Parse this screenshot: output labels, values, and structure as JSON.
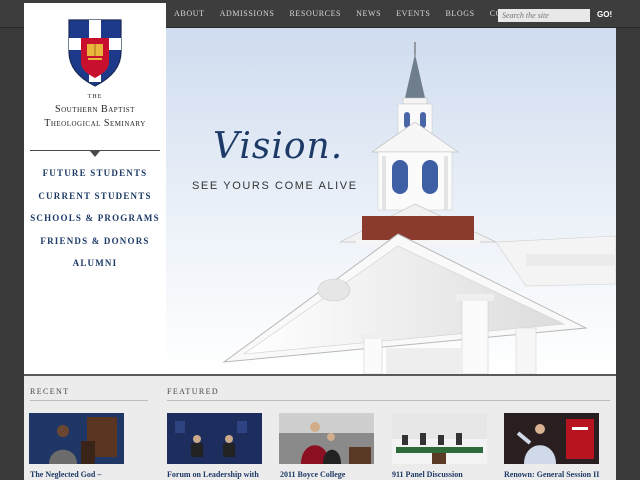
{
  "topnav": {
    "items": [
      "ABOUT",
      "ADMISSIONS",
      "RESOURCES",
      "NEWS",
      "EVENTS",
      "BLOGS",
      "CONTACT"
    ],
    "search_placeholder": "Search the site",
    "go_label": "GO!"
  },
  "logo": {
    "the": "THE",
    "line1": "Southern Baptist",
    "line2": "Theological Seminary"
  },
  "sidenav": {
    "items": [
      "FUTURE STUDENTS",
      "CURRENT STUDENTS",
      "SCHOOLS & PROGRAMS",
      "FRIENDS & DONORS",
      "ALUMNI"
    ]
  },
  "hero": {
    "headline": "Vision.",
    "tagline": "SEE YOURS COME ALIVE"
  },
  "recent": {
    "title": "RECENT",
    "items": [
      {
        "caption": "The Neglected God –"
      }
    ]
  },
  "featured": {
    "title": "FEATURED",
    "items": [
      {
        "caption": "Forum on Leadership with"
      },
      {
        "caption": "2011 Boyce College"
      },
      {
        "caption": "911 Panel Discussion"
      },
      {
        "caption": "Renown: General Session II"
      }
    ]
  },
  "colors": {
    "navy": "#1d3a66",
    "topbar": "#3d3d3d",
    "shield_red": "#c8102e",
    "shield_blue": "#1d3a8a"
  }
}
